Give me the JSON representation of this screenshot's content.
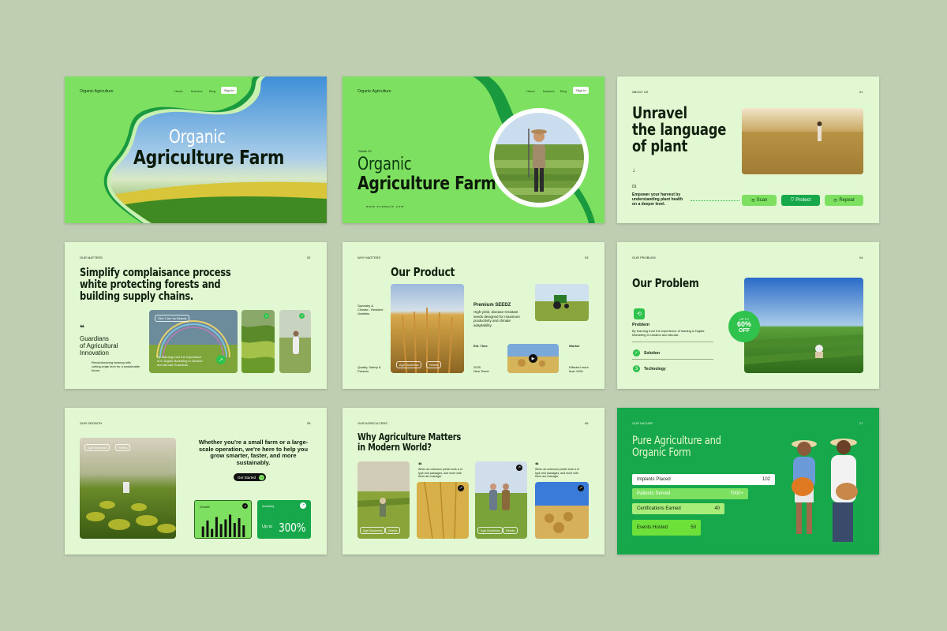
{
  "common": {
    "brand": "Organic Agriculture",
    "nav": [
      "Home",
      "features",
      "Blog"
    ],
    "signin": "Sign In"
  },
  "s1": {
    "title_line1": "Organic",
    "title_line2": "Agriculture Farm"
  },
  "s2": {
    "tag": "Slaide 02",
    "title_line1": "Organic",
    "title_line2": "Agriculture Farm",
    "url": "www.example.com"
  },
  "s3": {
    "label": "ABOUT US",
    "num": "01",
    "title_l1": "Unravel",
    "title_l2": "the language",
    "title_l3": "of plant",
    "arrow": "↓",
    "step": "01",
    "desc_l1": "Empower your harvest by",
    "desc_l2": "understanding plant health",
    "desc_l3": "on a  deeper level.",
    "buttons": [
      "Scan",
      "Protect",
      "Repeat"
    ]
  },
  "s4": {
    "label": "OUR MATTERS",
    "num": "02",
    "title_l1": "Simplify complaisance process",
    "title_l2": "white protecting forests and",
    "title_l3": "building supply chains.",
    "quote": "❝",
    "sub_l1": "Guardians",
    "sub_l2": "of Agricultural",
    "sub_l3": "Innovation",
    "small_l1": "Revolutionizing farming with",
    "small_l2": "cutting-edge tech for a sustainable",
    "small_l3": "future.",
    "chip": "Skin Care by Beauty",
    "overlay_l1": "By learning from the experience",
    "overlay_l2": "of in Digital Marketing in Ukraine",
    "overlay_l3": "and abroad Guardiola"
  },
  "s5": {
    "label": "WHY MATTERS",
    "num": "03",
    "title": "Our Product",
    "left1_l1": "Specialty &",
    "left1_l2": "Climate - Resilient",
    "left1_l3": "Varieties",
    "left2_l1": "Quality, Safety &",
    "left2_l2": "Passion",
    "premium": "Premium SEEDZ",
    "pdesc_l1": "High-yield, disease-resistant",
    "pdesc_l2": "seeds designed for maximum",
    "pdesc_l3": "productivity and climate",
    "pdesc_l4": "adaptability.",
    "est": "Est. Time",
    "worker": "Worker",
    "year": "2025",
    "team": "New Teach",
    "eff_l1": "Effected more",
    "eff_l2": "than 100k",
    "chips": [
      "Agri Business",
      "Seeds"
    ]
  },
  "s6": {
    "label": "OUR PROBLEM",
    "num": "04",
    "title": "Our Problem",
    "problem": "Problem",
    "pdesc_l1": "By learning from the experience of leading in Digital",
    "pdesc_l2": "Marketing in Ukraine and abroad.",
    "solution": "Solution",
    "technology": "Technology",
    "step3": "3",
    "badge_small": "UP TO",
    "badge_big": "60%",
    "badge_off": "OFF"
  },
  "s7": {
    "label": "OUR GROWTH",
    "num": "05",
    "chips": [
      "Agri Business",
      "Seeds"
    ],
    "text_l1": "Whether you're a small farm or a large-",
    "text_l2": "scale operation, we're here to help you",
    "text_l3": "grow smarter, faster, and more",
    "text_l4": "sustainably.",
    "cta": "Get Started",
    "growth": "Growth",
    "ancient": "Ancienty",
    "upto": "Up to",
    "pct": "300%",
    "chart_heights": [
      0.45,
      0.7,
      0.35,
      0.85,
      0.55,
      0.75,
      0.95,
      0.6,
      0.8,
      0.5
    ]
  },
  "s8": {
    "label": "OUR AGRICULTERS",
    "num": "06",
    "title_l1": "Why Agriculture Matters",
    "title_l2": "in Modern World?",
    "quote": "❝",
    "q_l1": "When an unknown printer took a of",
    "q_l2": "type and passages, and more with",
    "q_l3": "there are manager",
    "chips": [
      "Agri Business",
      "Seeds"
    ]
  },
  "s9": {
    "label": "OUR NATURE",
    "num": "07",
    "title_l1": "Pure Agriculture and",
    "title_l2": "Organic Form",
    "stats": [
      {
        "label": "Implants Placed",
        "value": "102"
      },
      {
        "label": "Patients Served",
        "value": "7000+"
      },
      {
        "label": "Certifications Earned",
        "value": "40"
      },
      {
        "label": "Events Hosted",
        "value": "50"
      }
    ]
  },
  "colors": {
    "green": "#7ee061",
    "dark_green": "#17a84c",
    "pale": "#e2f8d2",
    "bg": "#bfcdb1"
  }
}
